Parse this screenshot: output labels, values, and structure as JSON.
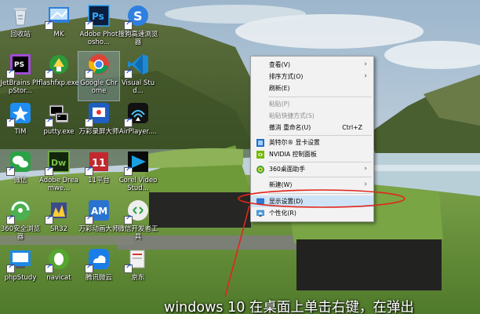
{
  "desktop": {
    "icons": [
      {
        "label": "回收站",
        "icon": "recycle-bin-icon"
      },
      {
        "label": "MK",
        "icon": "mk-icon"
      },
      {
        "label": "Adobe Photosho...",
        "icon": "photoshop-icon"
      },
      {
        "label": "搜狗高速浏览器",
        "icon": "sogou-browser-icon"
      },
      {
        "label": "JetBrains PhpStor...",
        "icon": "phpstorm-icon"
      },
      {
        "label": "flashfxp.exe",
        "icon": "flashfxp-icon"
      },
      {
        "label": "Google Chrome",
        "icon": "chrome-icon"
      },
      {
        "label": "Visual Stud...",
        "icon": "vscode-icon"
      },
      {
        "label": "TIM",
        "icon": "tim-icon"
      },
      {
        "label": "putty.exe",
        "icon": "putty-icon"
      },
      {
        "label": "万彩录屏大师",
        "icon": "wancai-recorder-icon"
      },
      {
        "label": "AirPlayer....",
        "icon": "airplayer-icon"
      },
      {
        "label": "微信",
        "icon": "wechat-icon"
      },
      {
        "label": "Adobe Dreamwe...",
        "icon": "dreamweaver-icon"
      },
      {
        "label": "11平台",
        "icon": "platform11-icon"
      },
      {
        "label": "Corel VideoStud...",
        "icon": "corel-videostudio-icon"
      },
      {
        "label": "360安全浏览器",
        "icon": "360-browser-icon"
      },
      {
        "label": "SR32",
        "icon": "sr32-icon"
      },
      {
        "label": "万彩动画大师",
        "icon": "wancai-animation-icon"
      },
      {
        "label": "微信开发者工具",
        "icon": "wechat-devtools-icon"
      },
      {
        "label": "phpStudy",
        "icon": "phpstudy-icon"
      },
      {
        "label": "navicat",
        "icon": "navicat-icon"
      },
      {
        "label": "腾讯微云",
        "icon": "weiyun-icon"
      },
      {
        "label": "京东",
        "icon": "jd-icon"
      }
    ]
  },
  "context_menu": {
    "items": [
      {
        "label": "查看(V)",
        "submenu": true
      },
      {
        "label": "排序方式(O)",
        "submenu": true
      },
      {
        "label": "刷新(E)"
      },
      {
        "label": "粘贴(P)",
        "disabled": true
      },
      {
        "label": "粘贴快捷方式(S)",
        "disabled": true
      },
      {
        "label": "撤消 重命名(U)",
        "shortcut": "Ctrl+Z"
      },
      {
        "label": "英特尔® 显卡设置",
        "icon": "intel-graphics-icon"
      },
      {
        "label": "NVIDIA 控制面板",
        "icon": "nvidia-icon"
      },
      {
        "label": "360桌面助手",
        "icon": "360-desktop-icon",
        "submenu": true
      },
      {
        "label": "新建(W)",
        "submenu": true
      },
      {
        "label": "显示设置(D)",
        "icon": "display-settings-icon",
        "highlighted": true
      },
      {
        "label": "个性化(R)",
        "icon": "personalize-icon"
      }
    ]
  },
  "annotation": {
    "caption": "windows 10  在桌面上单击右键，在弹出",
    "color": "#e0261c"
  },
  "colors": {
    "menu_bg": "#f2f2f2",
    "menu_highlight": "#cfe3f7",
    "disabled_text": "#8c8c8c"
  }
}
